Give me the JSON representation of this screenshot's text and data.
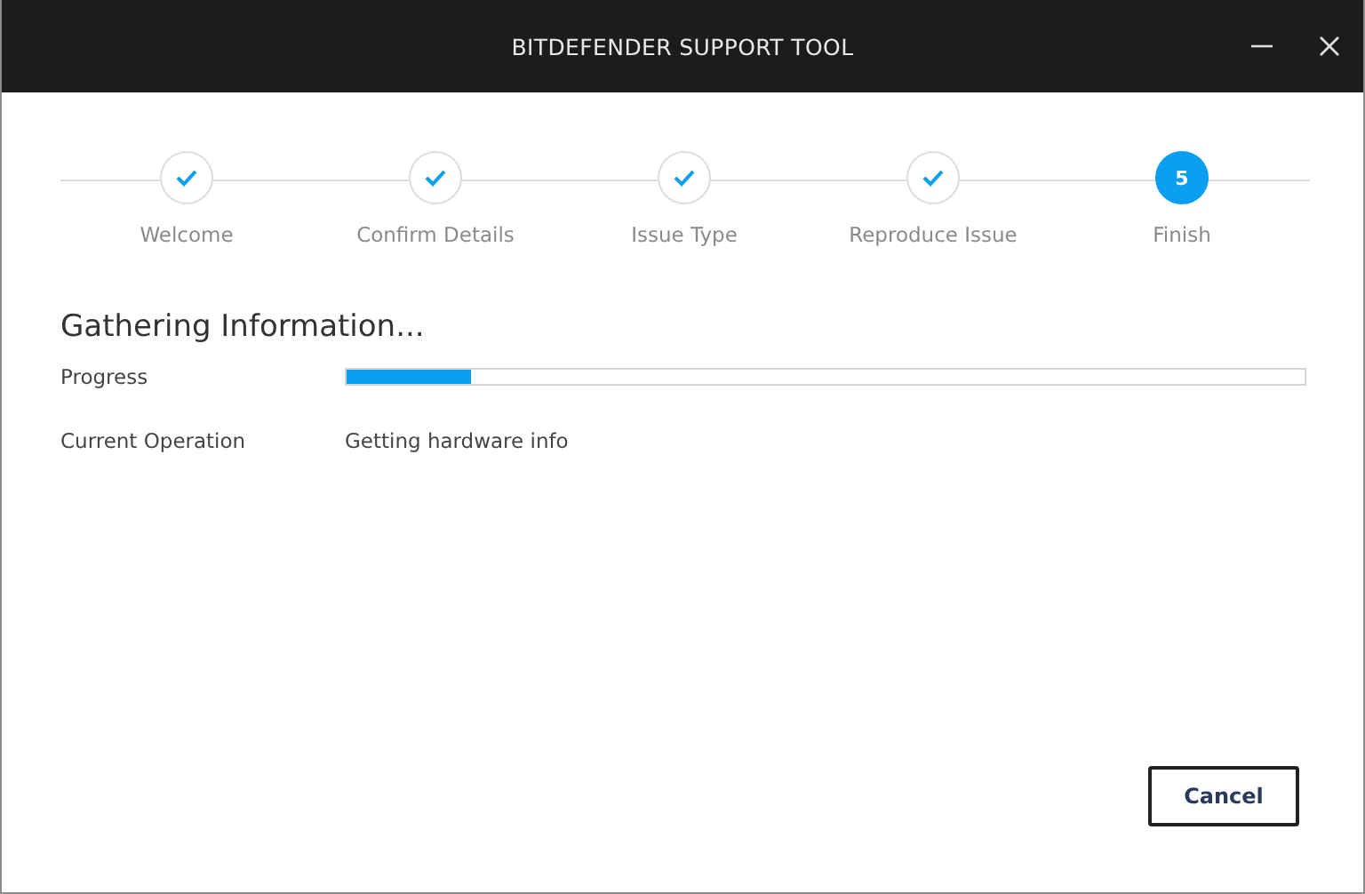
{
  "window": {
    "title": "BITDEFENDER SUPPORT TOOL",
    "controls": [
      {
        "kind": "minimize"
      },
      {
        "kind": "close"
      }
    ]
  },
  "steps": [
    {
      "label": "Welcome",
      "completed": true
    },
    {
      "label": "Confirm Details",
      "completed": true
    },
    {
      "label": "Issue Type",
      "completed": true
    },
    {
      "label": "Reproduce Issue",
      "completed": true
    },
    {
      "label": "Finish",
      "completed": false,
      "number": "5"
    }
  ],
  "heading": "Gathering Information...",
  "progress": {
    "label": "Progress",
    "level": 0.13
  },
  "operation": {
    "label": "Current Operation",
    "value": "Getting hardware info"
  },
  "buttons": [
    {
      "label": "Cancel"
    }
  ]
}
